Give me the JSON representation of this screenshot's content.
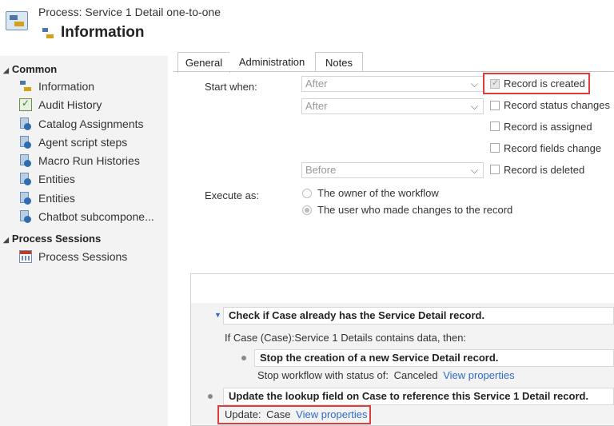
{
  "header": {
    "process_label": "Process: Service 1 Detail one-to-one",
    "title": "Information"
  },
  "sidebar": {
    "sections": [
      {
        "label": "Common"
      },
      {
        "label": "Process Sessions"
      }
    ],
    "items": [
      {
        "label": "Information",
        "icon": "process-icon"
      },
      {
        "label": "Audit History",
        "icon": "audit-icon"
      },
      {
        "label": "Catalog Assignments",
        "icon": "entity-icon"
      },
      {
        "label": "Agent script steps",
        "icon": "entity-icon"
      },
      {
        "label": "Macro Run Histories",
        "icon": "entity-icon"
      },
      {
        "label": "Entities",
        "icon": "entity-icon"
      },
      {
        "label": "Entities",
        "icon": "entity-icon"
      },
      {
        "label": "Chatbot subcompone...",
        "icon": "entity-icon"
      },
      {
        "label": "Process Sessions",
        "icon": "session-icon"
      }
    ]
  },
  "tabs": [
    {
      "label": "General",
      "active": true
    },
    {
      "label": "Administration",
      "active": false
    },
    {
      "label": "Notes",
      "active": false
    }
  ],
  "form": {
    "start_when_label": "Start when:",
    "execute_as_label": "Execute as:",
    "select1": "After",
    "select2": "After",
    "select3": "Before",
    "checkboxes": [
      {
        "label": "Record is created",
        "checked": true
      },
      {
        "label": "Record status changes",
        "checked": false
      },
      {
        "label": "Record is assigned",
        "checked": false
      },
      {
        "label": "Record fields change",
        "checked": false
      },
      {
        "label": "Record is deleted",
        "checked": false
      }
    ],
    "radios": [
      {
        "label": "The owner of the workflow",
        "selected": false
      },
      {
        "label": "The user who made changes to the record",
        "selected": true
      }
    ]
  },
  "workflow": {
    "step1_title": "Check if Case already has the Service Detail record.",
    "condition": "If Case (Case):Service 1 Details contains data, then:",
    "step2_title": "Stop the creation of a new Service Detail record.",
    "stop_text": "Stop workflow with status of:",
    "stop_status": "Canceled",
    "view_properties": "View properties",
    "step3_title": "Update the lookup field on Case to reference this Service 1 Detail record.",
    "update_label": "Update:",
    "update_entity": "Case"
  },
  "colors": {
    "highlight": "#e03c3c",
    "link": "#2f6bc4",
    "sidebar_bg": "#f3f3f3"
  }
}
